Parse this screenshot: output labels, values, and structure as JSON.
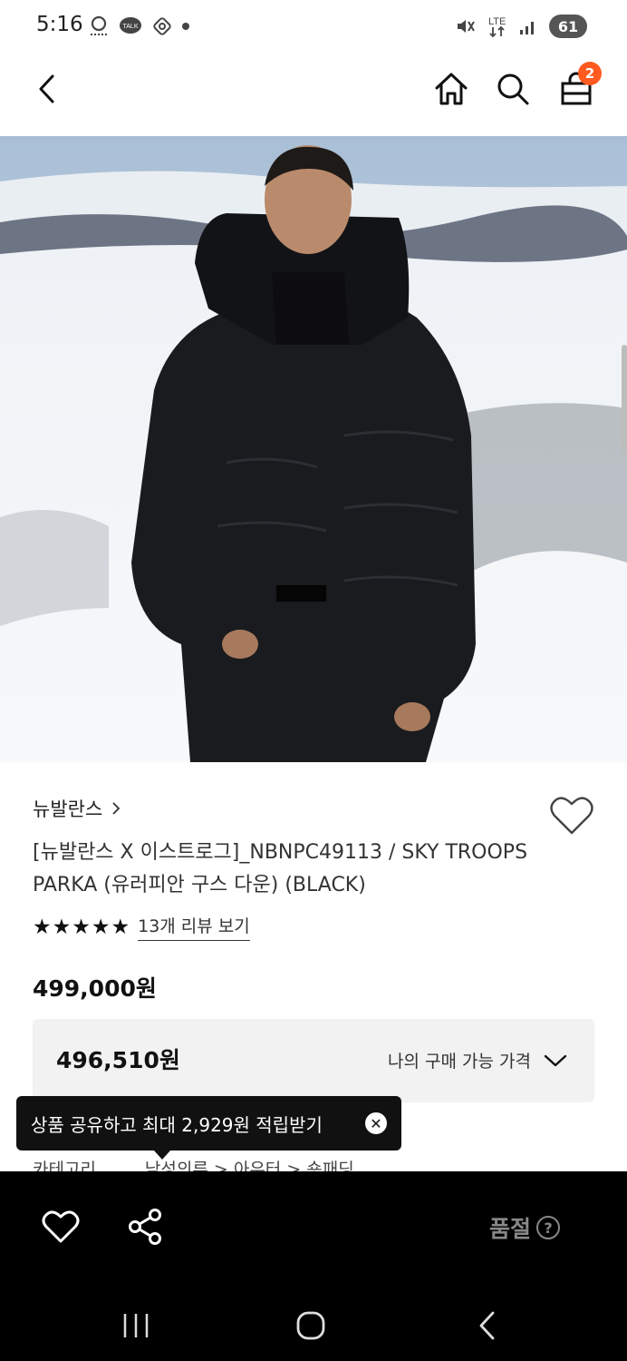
{
  "status_bar": {
    "time": "5:16",
    "battery": "61"
  },
  "product": {
    "brand": "뉴발란스",
    "title": "[뉴발란스 X 이스트로그]_NBNPC49113 / SKY TROOPS PARKA (유러피안 구스 다운) (BLACK)",
    "stars": "★★★★★",
    "review_link": "13개 리뷰 보기",
    "price": "499,000원",
    "my_price": "496,510원",
    "my_price_label": "나의 구매 가능 가격"
  },
  "tooltip": {
    "text": "상품 공유하고 최대 2,929원 적립받기",
    "close": "✕"
  },
  "category": {
    "label": "카테고리",
    "path": "남성의류 > 아우터 > 숏패딩"
  },
  "cart": {
    "count": "2"
  },
  "bottom_bar": {
    "status": "품절",
    "help": "?"
  },
  "colors": {
    "badge": "#ff5a1f",
    "bottom_bar_bg": "#000000",
    "buy_box_bg": "#f2f2f2"
  }
}
